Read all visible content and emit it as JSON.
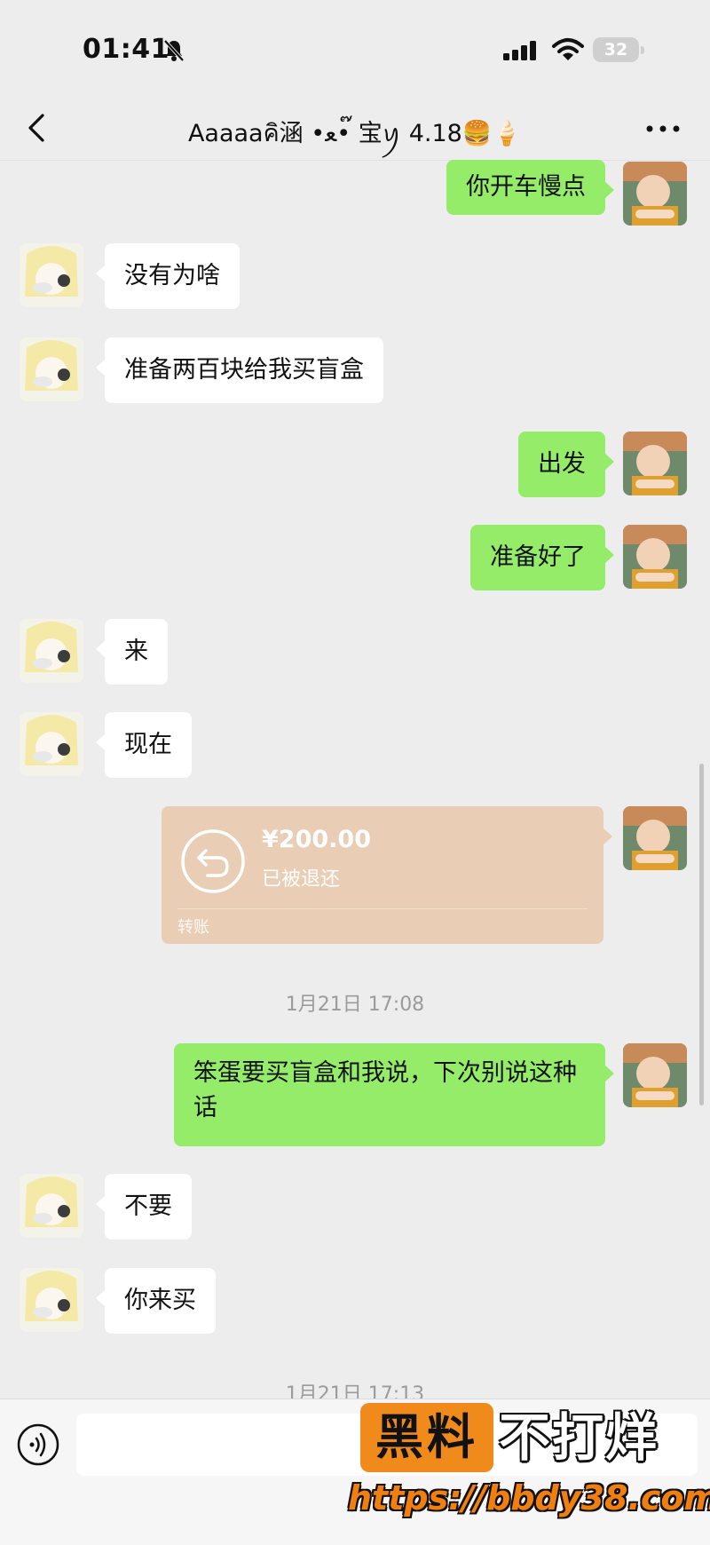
{
  "status_bar": {
    "time": "01:41",
    "battery": "32"
  },
  "nav": {
    "title": "Aaaaaคิ涵 •ﻌ•๊ 宝ꪗ 4.18🍔🍦"
  },
  "messages": [
    {
      "side": "me",
      "text": "你开车慢点"
    },
    {
      "side": "them",
      "text": "没有为啥"
    },
    {
      "side": "them",
      "text": "准备两百块给我买盲盒"
    },
    {
      "side": "me",
      "text": "出发"
    },
    {
      "side": "me",
      "text": "准备好了"
    },
    {
      "side": "them",
      "text": "来"
    },
    {
      "side": "them",
      "text": "现在"
    },
    {
      "side": "me",
      "text_line1": "笨蛋要买盲盒和我说，下次别说这种",
      "text_line2": "话"
    },
    {
      "side": "them",
      "text": "不要"
    },
    {
      "side": "them",
      "text": "你来买"
    }
  ],
  "transfer": {
    "amount": "¥200.00",
    "status": "已被退还",
    "label": "转账"
  },
  "timestamps": [
    "1月21日 17:08",
    "1月21日 17:13"
  ],
  "watermark": {
    "box_text": "黑料",
    "text": "不打烊",
    "url": "https://bbdy38.com"
  },
  "colors": {
    "my_bubble": "#95ec69",
    "their_bubble": "#ffffff",
    "transfer_card": "#e9cdb4",
    "background": "#ededed"
  }
}
